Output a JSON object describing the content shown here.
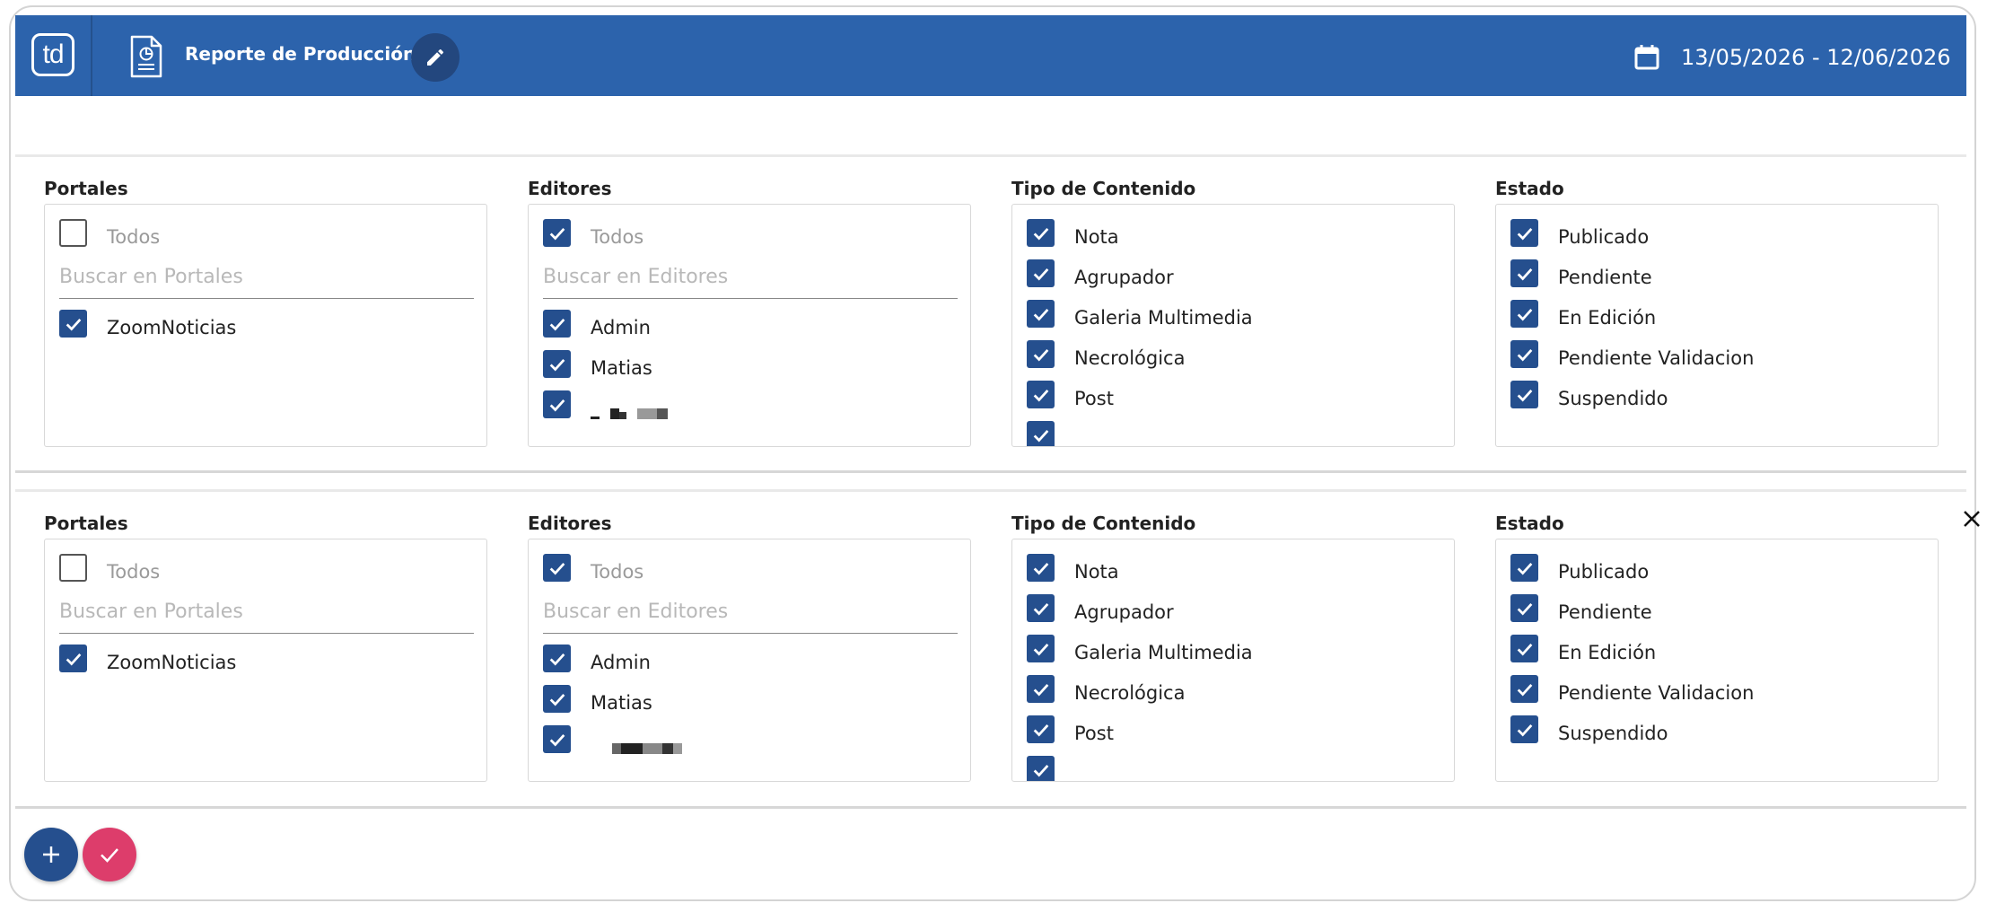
{
  "header": {
    "logo_text": "td",
    "report_title": "Reporte de Producción",
    "date_range": "13/05/2026 - 12/06/2026",
    "background_color": "#2c63ac"
  },
  "filters": [
    {
      "portales": {
        "title": "Portales",
        "all_label": "Todos",
        "all_checked": false,
        "search_placeholder": "Buscar en Portales",
        "items": [
          {
            "label": "ZoomNoticias",
            "checked": true
          }
        ]
      },
      "editores": {
        "title": "Editores",
        "all_label": "Todos",
        "all_checked": true,
        "search_placeholder": "Buscar en Editores",
        "items": [
          {
            "label": "Admin",
            "checked": true
          },
          {
            "label": "Matias",
            "checked": true
          }
        ]
      },
      "tipo": {
        "title": "Tipo de Contenido",
        "items": [
          {
            "label": "Nota",
            "checked": true
          },
          {
            "label": "Agrupador",
            "checked": true
          },
          {
            "label": "Galeria Multimedia",
            "checked": true
          },
          {
            "label": "Necrológica",
            "checked": true
          },
          {
            "label": "Post",
            "checked": true
          }
        ]
      },
      "estado": {
        "title": "Estado",
        "items": [
          {
            "label": "Publicado",
            "checked": true
          },
          {
            "label": "Pendiente",
            "checked": true
          },
          {
            "label": "En Edición",
            "checked": true
          },
          {
            "label": "Pendiente Validacion",
            "checked": true
          },
          {
            "label": "Suspendido",
            "checked": true
          }
        ]
      }
    },
    {
      "portales": {
        "title": "Portales",
        "all_label": "Todos",
        "all_checked": false,
        "search_placeholder": "Buscar en Portales",
        "items": [
          {
            "label": "ZoomNoticias",
            "checked": true
          }
        ]
      },
      "editores": {
        "title": "Editores",
        "all_label": "Todos",
        "all_checked": true,
        "search_placeholder": "Buscar en Editores",
        "items": [
          {
            "label": "Admin",
            "checked": true
          },
          {
            "label": "Matias",
            "checked": true
          }
        ]
      },
      "tipo": {
        "title": "Tipo de Contenido",
        "items": [
          {
            "label": "Nota",
            "checked": true
          },
          {
            "label": "Agrupador",
            "checked": true
          },
          {
            "label": "Galeria Multimedia",
            "checked": true
          },
          {
            "label": "Necrológica",
            "checked": true
          },
          {
            "label": "Post",
            "checked": true
          }
        ]
      },
      "estado": {
        "title": "Estado",
        "items": [
          {
            "label": "Publicado",
            "checked": true
          },
          {
            "label": "Pendiente",
            "checked": true
          },
          {
            "label": "En Edición",
            "checked": true
          },
          {
            "label": "Pendiente Validacion",
            "checked": true
          },
          {
            "label": "Suspendido",
            "checked": true
          }
        ]
      }
    }
  ],
  "icons": {
    "report": "report-chart-icon",
    "edit": "pencil-icon",
    "calendar": "calendar-icon",
    "close": "close-icon",
    "add": "plus-icon",
    "confirm": "check-icon"
  },
  "colors": {
    "checkbox": "#254f8e",
    "add_button": "#254f8e",
    "confirm_button": "#dd3d6b"
  }
}
